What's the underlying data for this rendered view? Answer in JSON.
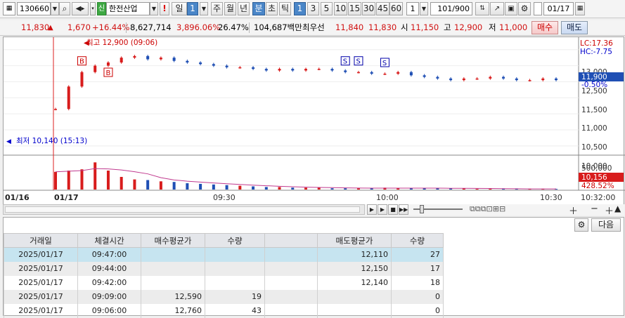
{
  "toolbar": {
    "code": "130660",
    "sin_badge": "신",
    "stock_name": "한전산업",
    "alert": "!",
    "period_day": "일",
    "period_num": "1",
    "periods": [
      "주",
      "월",
      "년",
      "분",
      "초",
      "틱"
    ],
    "intervals": [
      "1",
      "3",
      "5",
      "10",
      "15",
      "30",
      "45",
      "60"
    ],
    "count": "1",
    "page": "101/900",
    "date": "01/17"
  },
  "quote": {
    "price": "11,830",
    "arrow": "▲",
    "change": "1,670",
    "change_pct": "+16.44%",
    "volume": "8,627,714",
    "vol_ratio": "3,896.06%",
    "turnover": "26.47%",
    "amount": "104,687백만",
    "best_label": "최우선",
    "best_ask": "11,840",
    "best_bid": "11,830",
    "open_label": "시",
    "open": "11,150",
    "high_label": "고",
    "high": "12,900",
    "low_label": "저",
    "low": "11,000",
    "buy_btn": "매수",
    "sell_btn": "매도"
  },
  "chart": {
    "max_label": "최고 12,900 (09:06)",
    "min_label": "최저 10,140 (15:13)",
    "lc": "LC:17.36",
    "hc": "HC:-7.75",
    "cur_price": "11,900",
    "cur_pct": "-0.50%",
    "y_ticks": [
      "13,000",
      "12,500",
      "11,500",
      "11,000",
      "10,500",
      "10,000"
    ],
    "vol_tick": "500,000",
    "vol_cur": "10,156",
    "vol_pct": "428.52%",
    "x_labels": [
      "01/16",
      "01/17",
      "09:30",
      "10:00",
      "10:30",
      "10:32:00"
    ],
    "buy_marker": "B",
    "sell_marker": "S"
  },
  "chart_data": {
    "type": "candlestick",
    "x": [
      "09:00",
      "09:01",
      "09:02",
      "09:03",
      "09:04",
      "09:05",
      "09:06",
      "09:07",
      "09:08",
      "09:09",
      "09:10",
      "09:12",
      "09:14",
      "09:16",
      "09:18",
      "09:20",
      "09:22",
      "09:24",
      "09:26",
      "09:28",
      "09:30",
      "09:33",
      "09:36",
      "09:39",
      "09:42",
      "09:45",
      "09:48",
      "09:51",
      "09:54",
      "09:57",
      "10:00",
      "10:04",
      "10:08",
      "10:12",
      "10:16",
      "10:20",
      "10:24",
      "10:28",
      "10:31"
    ],
    "close": [
      11150,
      11850,
      12300,
      12500,
      12600,
      12750,
      12800,
      12700,
      12750,
      12650,
      12600,
      12550,
      12500,
      12450,
      12450,
      12400,
      12350,
      12400,
      12350,
      12400,
      12400,
      12350,
      12300,
      12300,
      12250,
      12250,
      12300,
      12200,
      12150,
      12100,
      12050,
      12100,
      12100,
      12150,
      12100,
      12050,
      12050,
      12100,
      12050
    ],
    "ylim": [
      9800,
      13300
    ],
    "ylabel": "",
    "volume": [
      280000,
      300000,
      320000,
      430000,
      300000,
      200000,
      160000,
      150000,
      130000,
      120000,
      100000,
      90000,
      80000,
      70000,
      60000,
      50000,
      40000,
      40000,
      30000,
      30000,
      30000,
      20000,
      20000,
      20000,
      20000,
      30000,
      20000,
      20000,
      20000,
      20000,
      20000,
      20000,
      10000,
      10000,
      10000,
      10000,
      10000,
      10000,
      10156
    ]
  },
  "table": {
    "toolbar_next": "다음",
    "headers": [
      "거래일",
      "체결시간",
      "매수평균가",
      "수량",
      "",
      "매도평균가",
      "수량"
    ],
    "rows": [
      [
        "2025/01/17",
        "09:47:00",
        "",
        "",
        "",
        "12,110",
        "27"
      ],
      [
        "2025/01/17",
        "09:44:00",
        "",
        "",
        "",
        "12,150",
        "17"
      ],
      [
        "2025/01/17",
        "09:42:00",
        "",
        "",
        "",
        "12,140",
        "18"
      ],
      [
        "2025/01/17",
        "09:09:00",
        "12,590",
        "19",
        "",
        "",
        "0"
      ],
      [
        "2025/01/17",
        "09:06:00",
        "12,760",
        "43",
        "",
        "",
        "0"
      ]
    ]
  }
}
